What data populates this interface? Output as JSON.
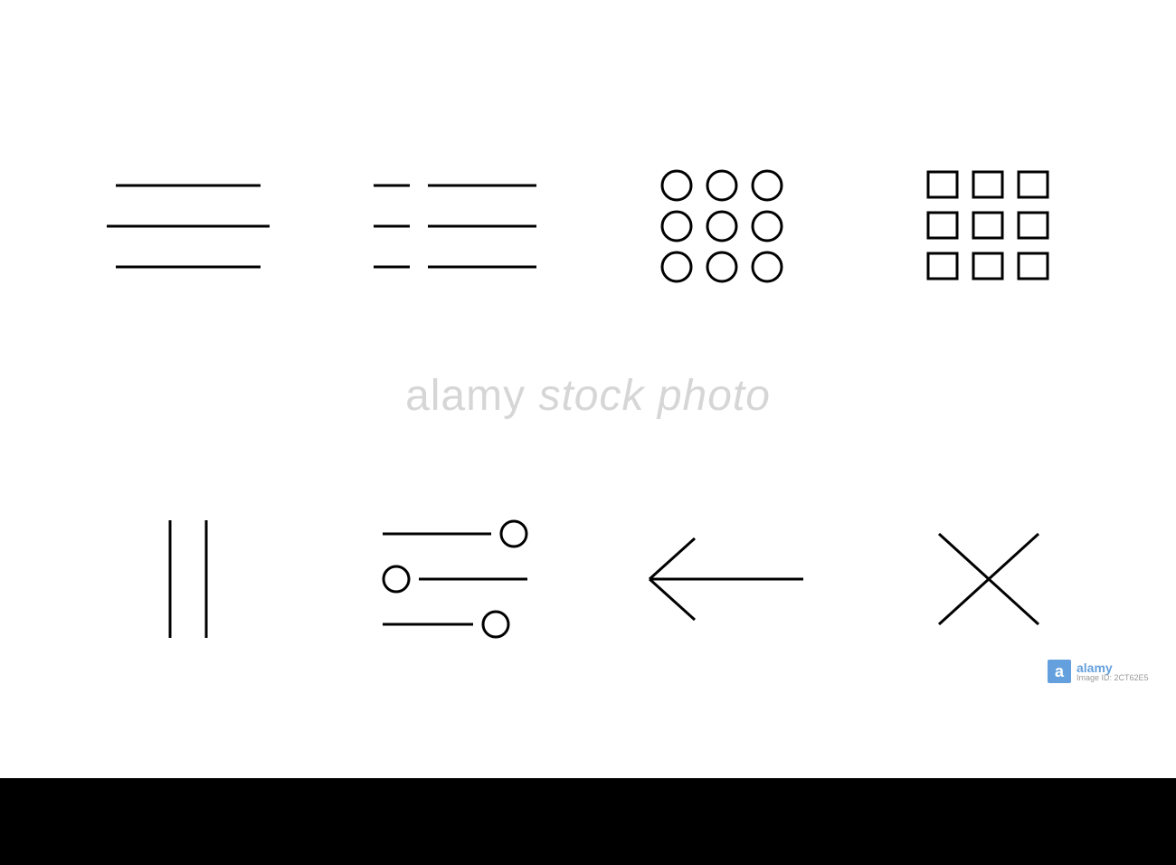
{
  "icons": {
    "row1": [
      "hamburger-menu",
      "list-menu",
      "grid-circles",
      "grid-squares"
    ],
    "row2": [
      "pause",
      "sliders-settings",
      "arrow-left",
      "close-x"
    ]
  },
  "watermark": {
    "brand_a": "a",
    "brand_text": "alamy",
    "brand_sub": "Image ID: 2CT62E5",
    "center_prefix": "alamy",
    "center_stock": "stock photo"
  },
  "footer": {},
  "colors": {
    "stroke": "#000000",
    "background": "#ffffff",
    "footer": "#000000",
    "watermark": "rgba(180,180,180,0.55)",
    "brand_blue": "#4a90d9"
  }
}
